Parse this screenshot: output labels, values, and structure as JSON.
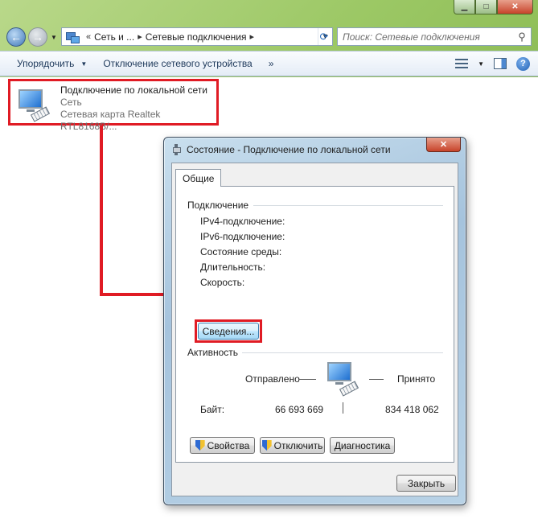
{
  "explorer": {
    "address": {
      "overflow": "«",
      "crumb1": "Сеть и ...",
      "crumb2": "Сетевые подключения",
      "separator": "▸"
    },
    "search_placeholder": "Поиск: Сетевые подключения",
    "commands": {
      "organize": "Упорядочить",
      "disable_device": "Отключение сетевого устройства",
      "more": "»"
    },
    "connection_item": {
      "name": "Подключение по локальной сети",
      "network": "Сеть",
      "adapter": "Сетевая карта Realtek RTL8168B/..."
    }
  },
  "dialog": {
    "title": "Состояние - Подключение по локальной сети",
    "tab": "Общие",
    "connection_section": {
      "label": "Подключение",
      "props": [
        "IPv4-подключение:",
        "IPv6-подключение:",
        "Состояние среды:",
        "Длительность:",
        "Скорость:"
      ]
    },
    "details_button": "Сведения...",
    "activity_section": {
      "label": "Активность",
      "sent_label": "Отправлено",
      "received_label": "Принято",
      "bytes_label": "Байт:",
      "bytes_sent": "66 693 669",
      "bytes_received": "834 418 062"
    },
    "buttons": {
      "properties": "Свойства",
      "disable": "Отключить",
      "diagnose": "Диагностика",
      "close": "Закрыть"
    }
  },
  "colors": {
    "highlight_frame": "#e01b24",
    "desktop_green": "#8cbc55"
  },
  "icons": {
    "back": "back-arrow-icon",
    "forward": "forward-arrow-icon",
    "refresh": "refresh-icon",
    "search": "search-icon",
    "help": "help-icon",
    "shield": "uac-shield-icon",
    "network": "network-adapter-icon"
  }
}
